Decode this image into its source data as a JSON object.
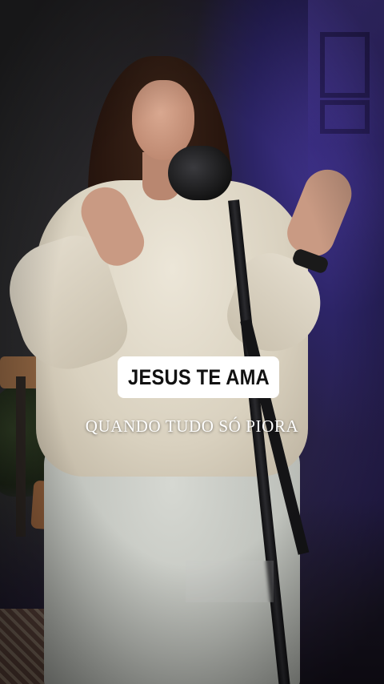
{
  "overlay": {
    "title": "JESUS TE AMA",
    "subtitle": "QUANDO TUDO SÓ PIORA"
  },
  "colors": {
    "title_bg": "#ffffff",
    "title_text": "#111111",
    "subtitle_text": "#ffffff",
    "accent_purple": "#4a3aa0"
  }
}
